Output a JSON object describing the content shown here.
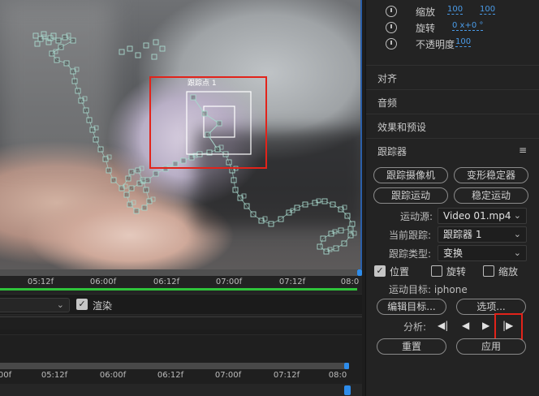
{
  "viewer": {
    "track_point_label": "跟踪点 1"
  },
  "timeline_top": {
    "ticks": [
      "05:12f",
      "06:00f",
      "06:12f",
      "07:00f",
      "07:12f",
      "08:0"
    ],
    "render_label": "渲染",
    "render_checked": true
  },
  "timeline_bottom": {
    "ticks": [
      "00f",
      "05:12f",
      "06:00f",
      "06:12f",
      "07:00f",
      "07:12f",
      "08:0"
    ]
  },
  "properties": {
    "scale": {
      "label": "缩放",
      "value_w": "100",
      "value_h": "100"
    },
    "rotation": {
      "label": "旋转",
      "value": "0 x+0 °"
    },
    "opacity": {
      "label": "不透明度",
      "value": "100"
    }
  },
  "panels": {
    "align": "对齐",
    "audio": "音频",
    "effects": "效果和预设",
    "tracker": "跟踪器",
    "menu_icon": "≡"
  },
  "tracker": {
    "buttons": {
      "track_camera": "跟踪摄像机",
      "warp_stabilizer": "变形稳定器",
      "track_motion": "跟踪运动",
      "stabilize_motion": "稳定运动",
      "edit_target": "编辑目标...",
      "options": "选项...",
      "reset": "重置",
      "apply": "应用"
    },
    "motion_source": {
      "label": "运动源:",
      "value": "Video 01.mp4"
    },
    "current_track": {
      "label": "当前跟踪:",
      "value": "跟踪器 1"
    },
    "track_type": {
      "label": "跟踪类型:",
      "value": "变换"
    },
    "checks": {
      "position": {
        "label": "位置",
        "checked": true
      },
      "rotation": {
        "label": "旋转",
        "checked": false
      },
      "scale": {
        "label": "缩放",
        "checked": false
      }
    },
    "motion_target": "运动目标: iphone",
    "analyze": {
      "label": "分析:",
      "icons": [
        "step-back-icon",
        "play-backward-icon",
        "play-forward-icon",
        "step-forward-icon"
      ],
      "glyphs": [
        "◀|",
        "◀",
        "▶",
        "|▶"
      ]
    }
  },
  "colors": {
    "highlight_red": "#e2231a",
    "accent_blue": "#2d8ceb",
    "value_blue": "#4a9be8",
    "work_area_green": "#2fc43b",
    "track_path": "#a8d8cc"
  }
}
